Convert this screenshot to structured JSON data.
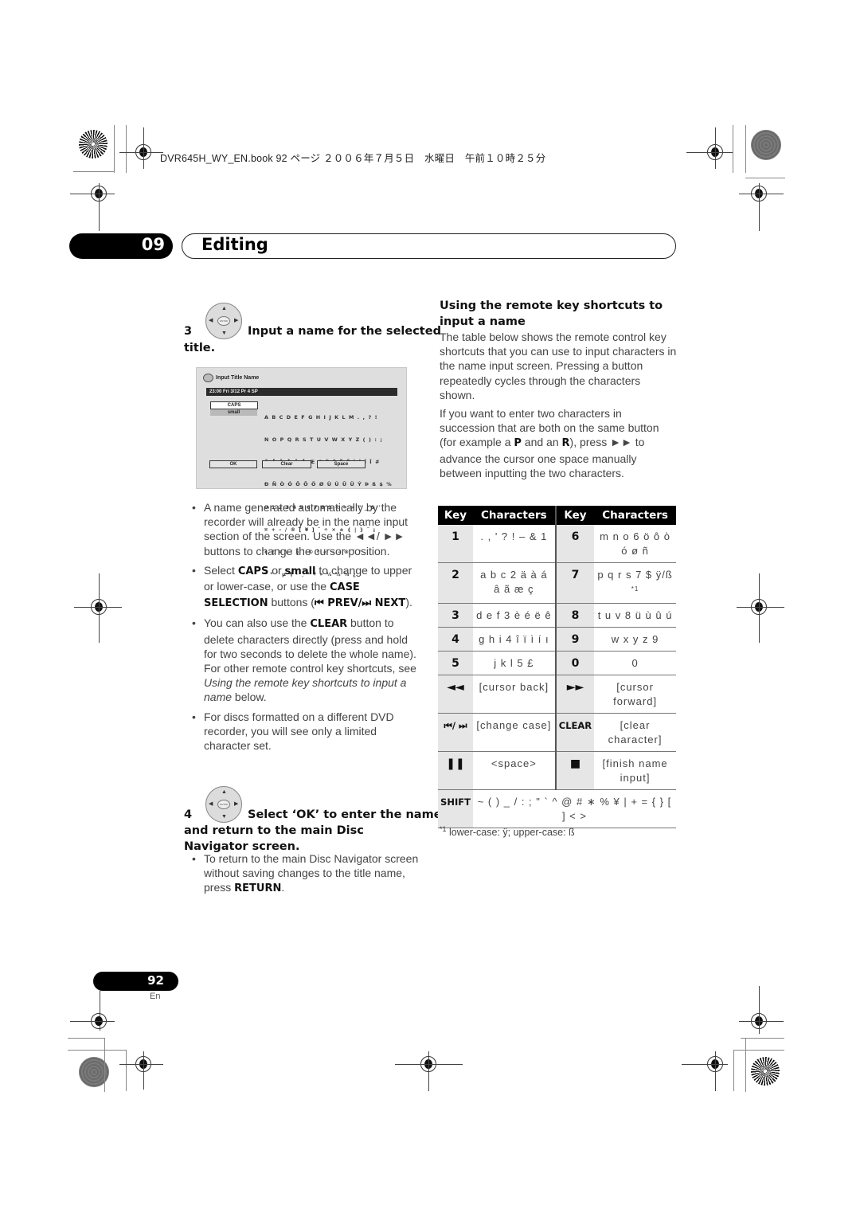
{
  "print_header": {
    "text": "DVR645H_WY_EN.book  92 ページ  ２００６年７月５日　水曜日　午前１０時２５分"
  },
  "chapter": {
    "number": "09",
    "title": "Editing"
  },
  "step3": {
    "number": "3",
    "heading_a": "Input a name for the selected",
    "heading_b": "title.",
    "dpad_center_label": "ENTER"
  },
  "screen": {
    "title": "Input Title Name",
    "status_bar": "23:00  Fri  3/12  Pr 4   SP",
    "case_options": [
      "CAPS",
      "small"
    ],
    "character_rows": [
      "A B C D E F G H I J K L M . , ? !",
      "N O P Q R S T U V W X Y Z ( ) : ;",
      "Ä Å Ä Å Ä Å Æ Ç È É Ë Ê Ì Í Î Ï #",
      "Ð Ñ Ò Ó Ô Õ Ö Ø Ù Ú Û Ü Ý Þ ß $ %",
      "0 1 2 3 4 5 6 7 8 9 < = > \" _ & '",
      "¤ + – / ® [ ¥ ] ˆ ÷ × ± { | } ˜ ¡",
      "¢ £ ¤ \\ ¦ § ¨ © ª « ¬ – ® ¯ °",
      "² ³ ´ µ ¶ · ¸ ¹ º » ¼ ½ ¾ ¿ `"
    ],
    "buttons": [
      "OK",
      "Clear",
      "Space"
    ]
  },
  "bullets_step3": [
    {
      "parts": [
        {
          "t": "A name generated automatically by the recorder will already be in the name input section of the screen. Use the ◄◄/ ►► buttons to change the cursor position."
        }
      ]
    },
    {
      "parts": [
        {
          "t": "Select "
        },
        {
          "b": "CAPS"
        },
        {
          "t": " or "
        },
        {
          "b": "small"
        },
        {
          "t": " to change to upper or lower-case, or use the "
        },
        {
          "b": "CASE SELECTION"
        },
        {
          "t": " buttons ("
        },
        {
          "b": "⏮ PREV/⏭ NEXT"
        },
        {
          "t": ")."
        }
      ]
    },
    {
      "parts": [
        {
          "t": "You can also use the "
        },
        {
          "b": "CLEAR"
        },
        {
          "t": " button to delete characters directly (press and hold for two seconds to delete the whole name). For other remote control key shortcuts, see "
        },
        {
          "i": "Using the remote key shortcuts to input a name"
        },
        {
          "t": " below."
        }
      ]
    },
    {
      "parts": [
        {
          "t": "For discs formatted on a different DVD recorder, you will see only a limited character set."
        }
      ]
    }
  ],
  "step4": {
    "number": "4",
    "heading_a": "Select ‘OK’ to enter the name",
    "heading_b": "and return to the main Disc Navigator screen.",
    "dpad_center_label": "ENTER",
    "bullet_text_a": "To return to the main Disc Navigator screen without saving changes to the title name, press ",
    "bullet_bold": "RETURN",
    "bullet_text_b": "."
  },
  "shortcuts_section": {
    "title": "Using the remote key shortcuts to input a name",
    "para1": "The table below shows the remote control key shortcuts that you can use to input characters in the name input screen. Pressing a button repeatedly cycles through the characters shown.",
    "para2_a": "If you want to enter two characters in succession that are both on the same button (for example a ",
    "para2_p": "P",
    "para2_b": " and an ",
    "para2_r": "R",
    "para2_c": "), press ►► to advance the cursor one space manually between inputting the two characters."
  },
  "key_table": {
    "headers": [
      "Key",
      "Characters",
      "Key",
      "Characters"
    ],
    "rows": [
      {
        "k1": "1",
        "c1": ". , ' ? ! – & 1",
        "k2": "6",
        "c2": "m n o 6 ö ô ò ó ø ñ"
      },
      {
        "k1": "2",
        "c1": "a b c 2 ä à á â ã æ ç",
        "k2": "7",
        "c2": "p q r s 7 $ ÿ/ß",
        "c2_note": "*1"
      },
      {
        "k1": "3",
        "c1": "d e f 3 è é ë ê",
        "k2": "8",
        "c2": "t u v 8 ü ù û ú"
      },
      {
        "k1": "4",
        "c1": "g h i 4 î ï ì í ı",
        "k2": "9",
        "c2": "w x y z 9"
      },
      {
        "k1": "5",
        "c1": "j k l 5 £",
        "k2": "0",
        "c2": "0"
      },
      {
        "k1": "◄◄",
        "c1": "[cursor back]",
        "k2": "►►",
        "c2": "[cursor forward]"
      },
      {
        "k1": "⏮/ ⏭",
        "c1": "[change case]",
        "k2": "CLEAR",
        "c2": "[clear character]"
      },
      {
        "k1": "❚❚",
        "c1": "<space>",
        "k2": "■",
        "c2": "[finish name input]"
      }
    ],
    "shift_row": {
      "k": "SHIFT",
      "c": "~ ( ) _ / : ; \" ` ^ @ # ∗ % ¥ | + = { } [ ] < >"
    }
  },
  "footnote": {
    "marker": "*1",
    "text": "lower-case: ÿ; upper-case: ß"
  },
  "page": {
    "number": "92",
    "language": "En"
  }
}
